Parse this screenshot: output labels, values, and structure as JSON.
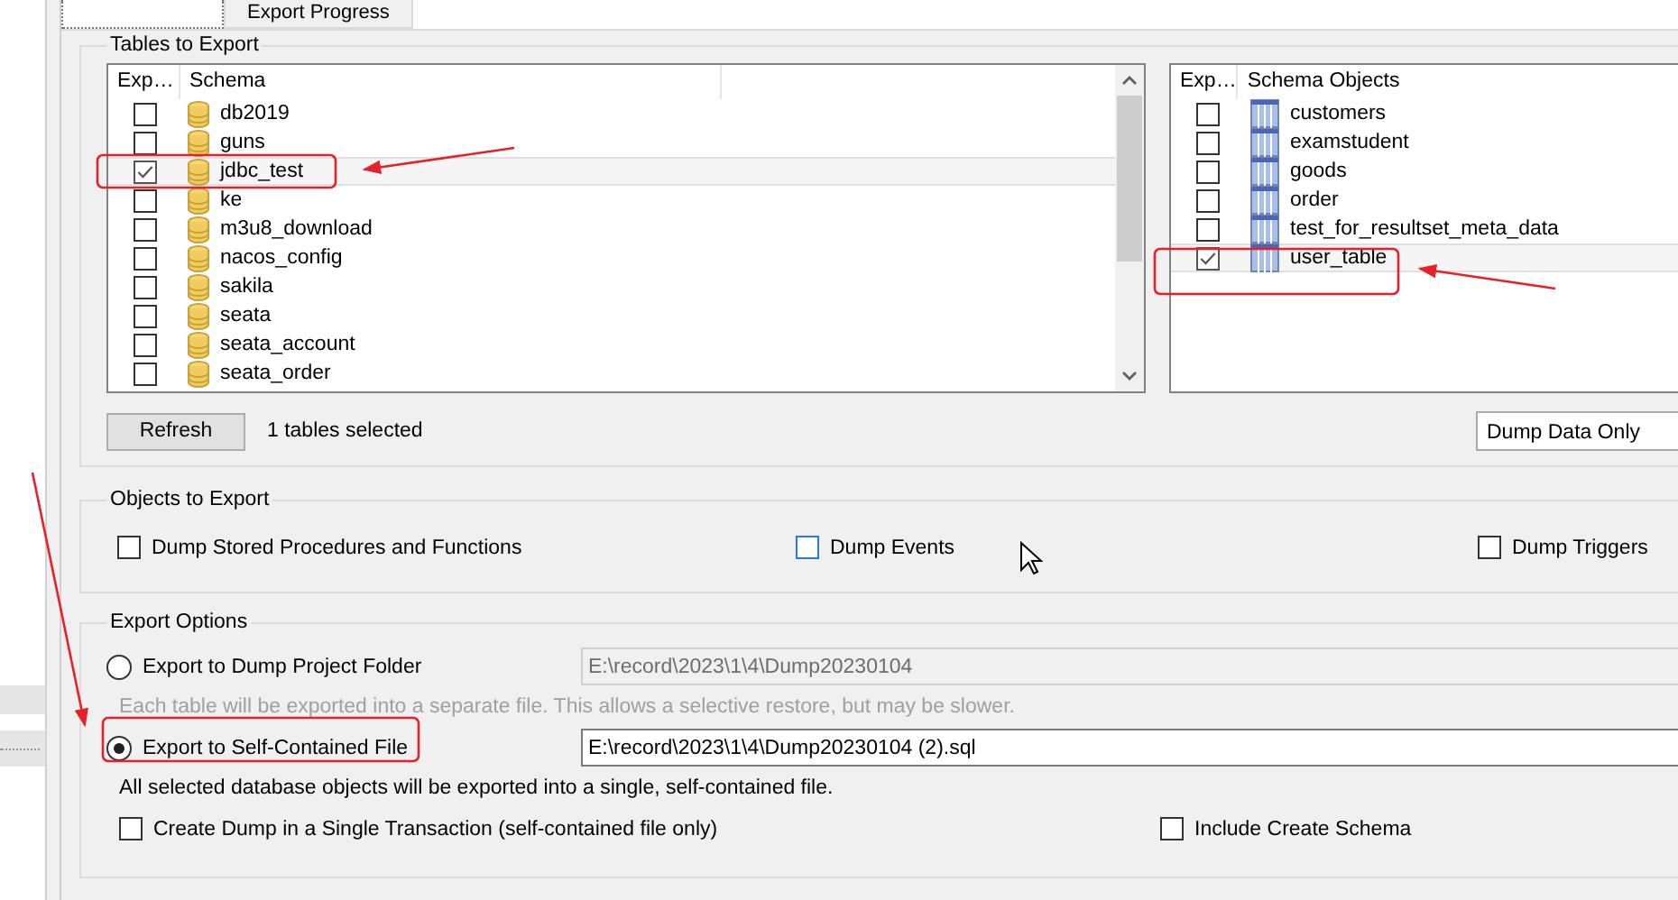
{
  "tabs": [
    {
      "selected": true
    },
    {
      "label": "Export Progress",
      "selected": false
    }
  ],
  "tables_to_export": {
    "title": "Tables to Export",
    "schema_list": {
      "columns": [
        "Exp…",
        "Schema"
      ],
      "rows": [
        {
          "name": "db2019",
          "checked": false,
          "selected": false
        },
        {
          "name": "guns",
          "checked": false,
          "selected": false
        },
        {
          "name": "jdbc_test",
          "checked": true,
          "selected": true
        },
        {
          "name": "ke",
          "checked": false,
          "selected": false
        },
        {
          "name": "m3u8_download",
          "checked": false,
          "selected": false
        },
        {
          "name": "nacos_config",
          "checked": false,
          "selected": false
        },
        {
          "name": "sakila",
          "checked": false,
          "selected": false
        },
        {
          "name": "seata",
          "checked": false,
          "selected": false
        },
        {
          "name": "seata_account",
          "checked": false,
          "selected": false
        },
        {
          "name": "seata_order",
          "checked": false,
          "selected": false
        }
      ]
    },
    "objects_list": {
      "columns": [
        "Exp…",
        "Schema Objects"
      ],
      "rows": [
        {
          "name": "customers",
          "checked": false,
          "selected": false
        },
        {
          "name": "examstudent",
          "checked": false,
          "selected": false
        },
        {
          "name": "goods",
          "checked": false,
          "selected": false
        },
        {
          "name": "order",
          "checked": false,
          "selected": false
        },
        {
          "name": "test_for_resultset_meta_data",
          "checked": false,
          "selected": false
        },
        {
          "name": "user_table",
          "checked": true,
          "selected": true
        }
      ]
    },
    "refresh_button": "Refresh",
    "selection_count": "1 tables selected",
    "dump_mode": "Dump Data Only"
  },
  "objects_to_export": {
    "title": "Objects to Export",
    "options": [
      {
        "label": "Dump Stored Procedures and Functions",
        "checked": false,
        "hovered": false
      },
      {
        "label": "Dump Events",
        "checked": false,
        "hovered": true
      },
      {
        "label": "Dump Triggers",
        "checked": false,
        "hovered": false
      }
    ]
  },
  "export_options": {
    "title": "Export Options",
    "targets": [
      {
        "label": "Export to Dump Project Folder",
        "selected": false,
        "path": "E:\\record\\2023\\1\\4\\Dump20230104",
        "note": "Each table will be exported into a separate file. This allows a selective restore, but may be slower."
      },
      {
        "label": "Export to Self-Contained File",
        "selected": true,
        "path": "E:\\record\\2023\\1\\4\\Dump20230104 (2).sql",
        "note": "All selected database objects will be exported into a single, self-contained file."
      }
    ],
    "options": [
      {
        "label": "Create Dump in a Single Transaction (self-contained file only)",
        "checked": false
      },
      {
        "label": "Include Create Schema",
        "checked": false
      }
    ]
  }
}
